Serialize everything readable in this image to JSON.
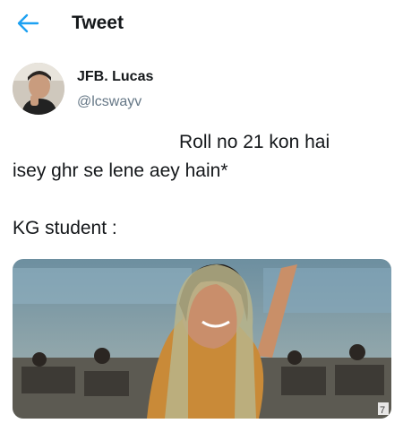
{
  "header": {
    "title": "Tweet",
    "back_icon": "arrow-left-icon",
    "accent_color": "#1da1f2"
  },
  "author": {
    "display_name": "JFB. Lucas",
    "handle": "@lcswayv"
  },
  "tweet": {
    "line1": "Roll no 21 kon hai",
    "line2": "isey ghr se lene aey hain*",
    "line3": "KG student :"
  },
  "media": {
    "description_icon": "photo-image",
    "corner_badge": "7"
  }
}
